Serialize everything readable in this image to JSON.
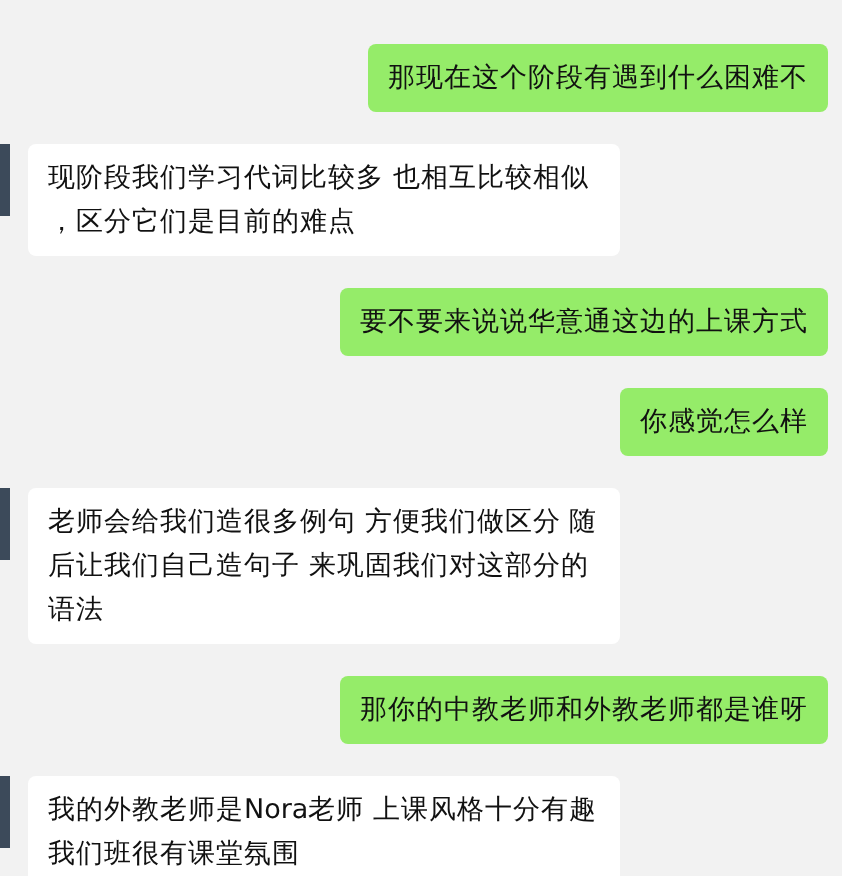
{
  "messages": [
    {
      "kind": "sent",
      "text": "那现在这个阶段有遇到什么困难不"
    },
    {
      "kind": "received",
      "text": "现阶段我们学习代词比较多 也相互比较相似，区分它们是目前的难点"
    },
    {
      "kind": "sent",
      "text": "要不要来说说华意通这边的上课方式"
    },
    {
      "kind": "sent",
      "text": "你感觉怎么样"
    },
    {
      "kind": "received",
      "text": "老师会给我们造很多例句 方便我们做区分 随后让我们自己造句子 来巩固我们对这部分的语法"
    },
    {
      "kind": "sent",
      "text": "那你的中教老师和外教老师都是谁呀"
    },
    {
      "kind": "received",
      "text": "我的外教老师是Nora老师 上课风格十分有趣我们班很有课堂氛围"
    }
  ]
}
